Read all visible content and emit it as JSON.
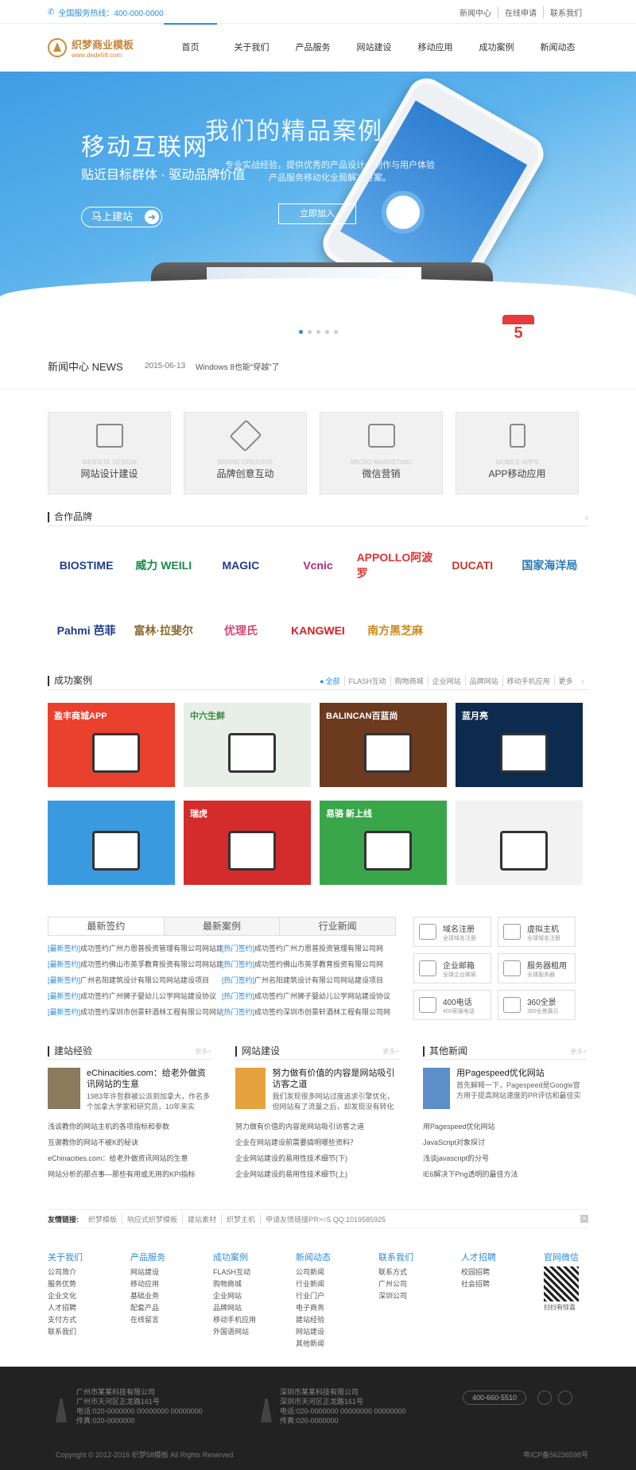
{
  "topbar": {
    "hotline": "全国服务热线：400-000-0000",
    "links": [
      "新闻中心",
      "在线申请",
      "联系我们"
    ]
  },
  "header": {
    "logo_title": "织梦商业模板",
    "logo_url": "www.dede58.com",
    "nav": [
      "首页",
      "关于我们",
      "产品服务",
      "网站建设",
      "移动应用",
      "成功案例",
      "新闻动态"
    ]
  },
  "banner": {
    "headline": "移动互联网",
    "headline_overlay": "我们的精品案例",
    "subline": "贴近目标群体 · 驱动品牌价值",
    "subline_overlay": "专业实战经验，提供优秀的产品设计、制作与用户体验产品服务移动化全局解决方案。",
    "cta": "马上建站",
    "cta_overlay": "立即加入",
    "calendar_num": "5"
  },
  "newsbar": {
    "title": "新闻中心 NEWS",
    "date": "2015-06-13",
    "item": "Windows 8也能“穿越”了"
  },
  "services": [
    {
      "en": "WEBSITE DESIGN",
      "cn": "网站设计建设",
      "icon": "layout-icon"
    },
    {
      "en": "BRAND CREATIVE",
      "cn": "品牌创意互动",
      "icon": "tools-icon"
    },
    {
      "en": "MICRO MARKETING",
      "cn": "微信营销",
      "icon": "chat-icon"
    },
    {
      "en": "MOBILE APPS",
      "cn": "APP移动应用",
      "icon": "mobile-icon"
    }
  ],
  "brands_section": {
    "title": "合作品牌",
    "brands": [
      "BIOSTIME",
      "威力 WEILI",
      "MAGIC",
      "Vcnic",
      "APPOLLO阿波罗",
      "DUCATI",
      "国家海洋局",
      "Pahmi 芭菲",
      "富林·拉斐尔",
      "优理氏",
      "KANGWEI",
      "南方黑芝麻"
    ],
    "colors": [
      "#1d3f8f",
      "#1a8a4c",
      "#1e3d8f",
      "#b0287c",
      "#d33",
      "#c0392b",
      "#2a7ab5",
      "#1e3a8a",
      "#8b6b2e",
      "#d94675",
      "#d42027",
      "#c98b1e"
    ]
  },
  "cases_section": {
    "title": "成功案例",
    "cats": [
      "全部",
      "FLASH互动",
      "购物商城",
      "企业网站",
      "品牌网站",
      "移动手机应用",
      "更多"
    ],
    "cases": [
      {
        "label": "盈丰商城APP",
        "bg": "#e9412d"
      },
      {
        "label": "中六生鲜",
        "bg": "#e8efe9"
      },
      {
        "label": "BALINCAN百蓝尚",
        "bg": "#6b3a1f"
      },
      {
        "label": "蓝月亮",
        "bg": "#0d2a4f"
      },
      {
        "label": "",
        "bg": "#3a9ae0"
      },
      {
        "label": "瑞虎",
        "bg": "#d42c2c"
      },
      {
        "label": "易骆 新上线",
        "bg": "#3aa64a"
      },
      {
        "label": "",
        "bg": "#f2f2f2"
      }
    ]
  },
  "news_tabs": {
    "tabs": [
      "最新签约",
      "最新案例",
      "行业新闻"
    ],
    "rows": [
      {
        "t1": "[最新签约]",
        "c1": "成功签约广州力恩普投资管理有限公司网站建设",
        "t2": "[热门签约]",
        "c2": "成功签约广州力恩普投资管理有限公司网"
      },
      {
        "t1": "[最新签约]",
        "c1": "成功签约佛山市英孚教育投资有限公司网站建设",
        "t2": "[热门签约]",
        "c2": "成功签约佛山市英孚教育投资有限公司网"
      },
      {
        "t1": "[最新签约]",
        "c1": "广州名阳建筑设计有限公司网站建设项目",
        "t2": "[热门签约]",
        "c2": "广州名阳建筑设计有限公司网站建设项目"
      },
      {
        "t1": "[最新签约]",
        "c1": "成功签约广州狮子婴幼儿公学网站建设协议",
        "t2": "[热门签约]",
        "c2": "成功签约广州狮子婴幼儿公学网站建设协议"
      },
      {
        "t1": "[最新签约]",
        "c1": "成功签约深圳市创景轩酒林工程有限公司网站建设",
        "t2": "[热门签约]",
        "c2": "成功签约深圳市创景轩酒林工程有限公司网"
      }
    ]
  },
  "service_cards": [
    {
      "t1": "域名注册",
      "t2": "全球域名注册",
      "icon": "com-icon"
    },
    {
      "t1": "虚拟主机",
      "t2": "全球域名注册",
      "icon": "server-icon"
    },
    {
      "t1": "企业邮箱",
      "t2": "全球企业邮局",
      "icon": "mail-icon"
    },
    {
      "t1": "服务器租用",
      "t2": "全球服务器",
      "icon": "rack-icon"
    },
    {
      "t1": "400电话",
      "t2": "400客服电话",
      "icon": "phone-icon"
    },
    {
      "t1": "360全景",
      "t2": "360全景展示",
      "icon": "panorama-icon"
    }
  ],
  "articles": [
    {
      "title": "建站经验",
      "more": "更多+",
      "top_title": "eChinacities.com：给老外做资讯网站的生意",
      "top_text": "1983年许哲群被公派到加拿大，作名多个加拿大学家和研究员，10年来实",
      "thumb": "#8a7a5e",
      "list": [
        "浅谈教你的网站主机的各项指标和参数",
        "互谢教你的网站不被K的秘诀",
        "eChinacities.com：给老外做资讯网站的生意",
        "网站分析的那点事—那些有用或无用的KPI指标"
      ]
    },
    {
      "title": "网站建设",
      "more": "更多+",
      "top_title": "努力做有价值的内容是网站吸引访客之道",
      "top_text": "我们发现很多网站过度追求引擎优化，但网站有了流量之后，却发现没有转化率",
      "thumb": "#e6a23c",
      "list": [
        "努力做有价值的内容是网站吸引访客之道",
        "企业在网站建设前需要搞明哪些资料？",
        "企业网站建设的易用性技术细节(下)",
        "企业网站建设的易用性技术细节(上)"
      ]
    },
    {
      "title": "其他新闻",
      "more": "更多+",
      "top_title": "用Pagespeed优化网站",
      "top_text": "首先解释一下，Pagespeed是Google官方用于提高网站速度的PR评估和最佳实践的一个基于",
      "thumb": "#5d8fc9",
      "list": [
        "用Pagespeed优化网站",
        "JavaScript对象探讨",
        "浅谈javascript的分号",
        "IE6解决下Png透明的最佳方法"
      ]
    }
  ],
  "friends": {
    "label": "友情链接:",
    "links": [
      "织梦模板",
      "响应式织梦模板",
      "建站素材",
      "织梦主机",
      "申请友情链接PR>=5 QQ:1019585925"
    ],
    "close": "×"
  },
  "footer_nav": [
    {
      "h": "关于我们",
      "items": [
        "公司简介",
        "服务优势",
        "企业文化",
        "人才招聘",
        "支付方式",
        "联系我们"
      ]
    },
    {
      "h": "产品服务",
      "items": [
        "网站建设",
        "移动应用",
        "基础业务",
        "配套产品",
        "在线留言"
      ]
    },
    {
      "h": "成功案例",
      "items": [
        "FLASH互动",
        "购物商城",
        "企业网站",
        "品牌网站",
        "移动手机应用",
        "外国语网站"
      ]
    },
    {
      "h": "新闻动态",
      "items": [
        "公司新闻",
        "行业新闻",
        "行业门户",
        "电子商务",
        "建站经验",
        "网站建设",
        "其他新闻"
      ]
    },
    {
      "h": "联系我们",
      "items": [
        "联系方式",
        "广州公司",
        "深圳公司"
      ]
    },
    {
      "h": "人才招聘",
      "items": [
        "校园招聘",
        "社会招聘"
      ]
    }
  ],
  "wechat": {
    "h": "官网微信",
    "caption": "扫扫有惊喜"
  },
  "footer": {
    "addr1": [
      "广州市某某科技有限公司",
      "广州市天河区正龙路161号",
      "电话:020-0000000 00000000 00000000",
      "传真:020-0000000"
    ],
    "addr2": [
      "深圳市某某科技有限公司",
      "深圳市天河区正龙路161号",
      "电话:020-0000000 00000000 00000000",
      "传真:020-0000000"
    ],
    "phone": "400-660-5510",
    "copyright": "Copyright © 2012-2016 织梦58模板 All Rights Reserved",
    "icp": "粤ICP备56236598号"
  }
}
